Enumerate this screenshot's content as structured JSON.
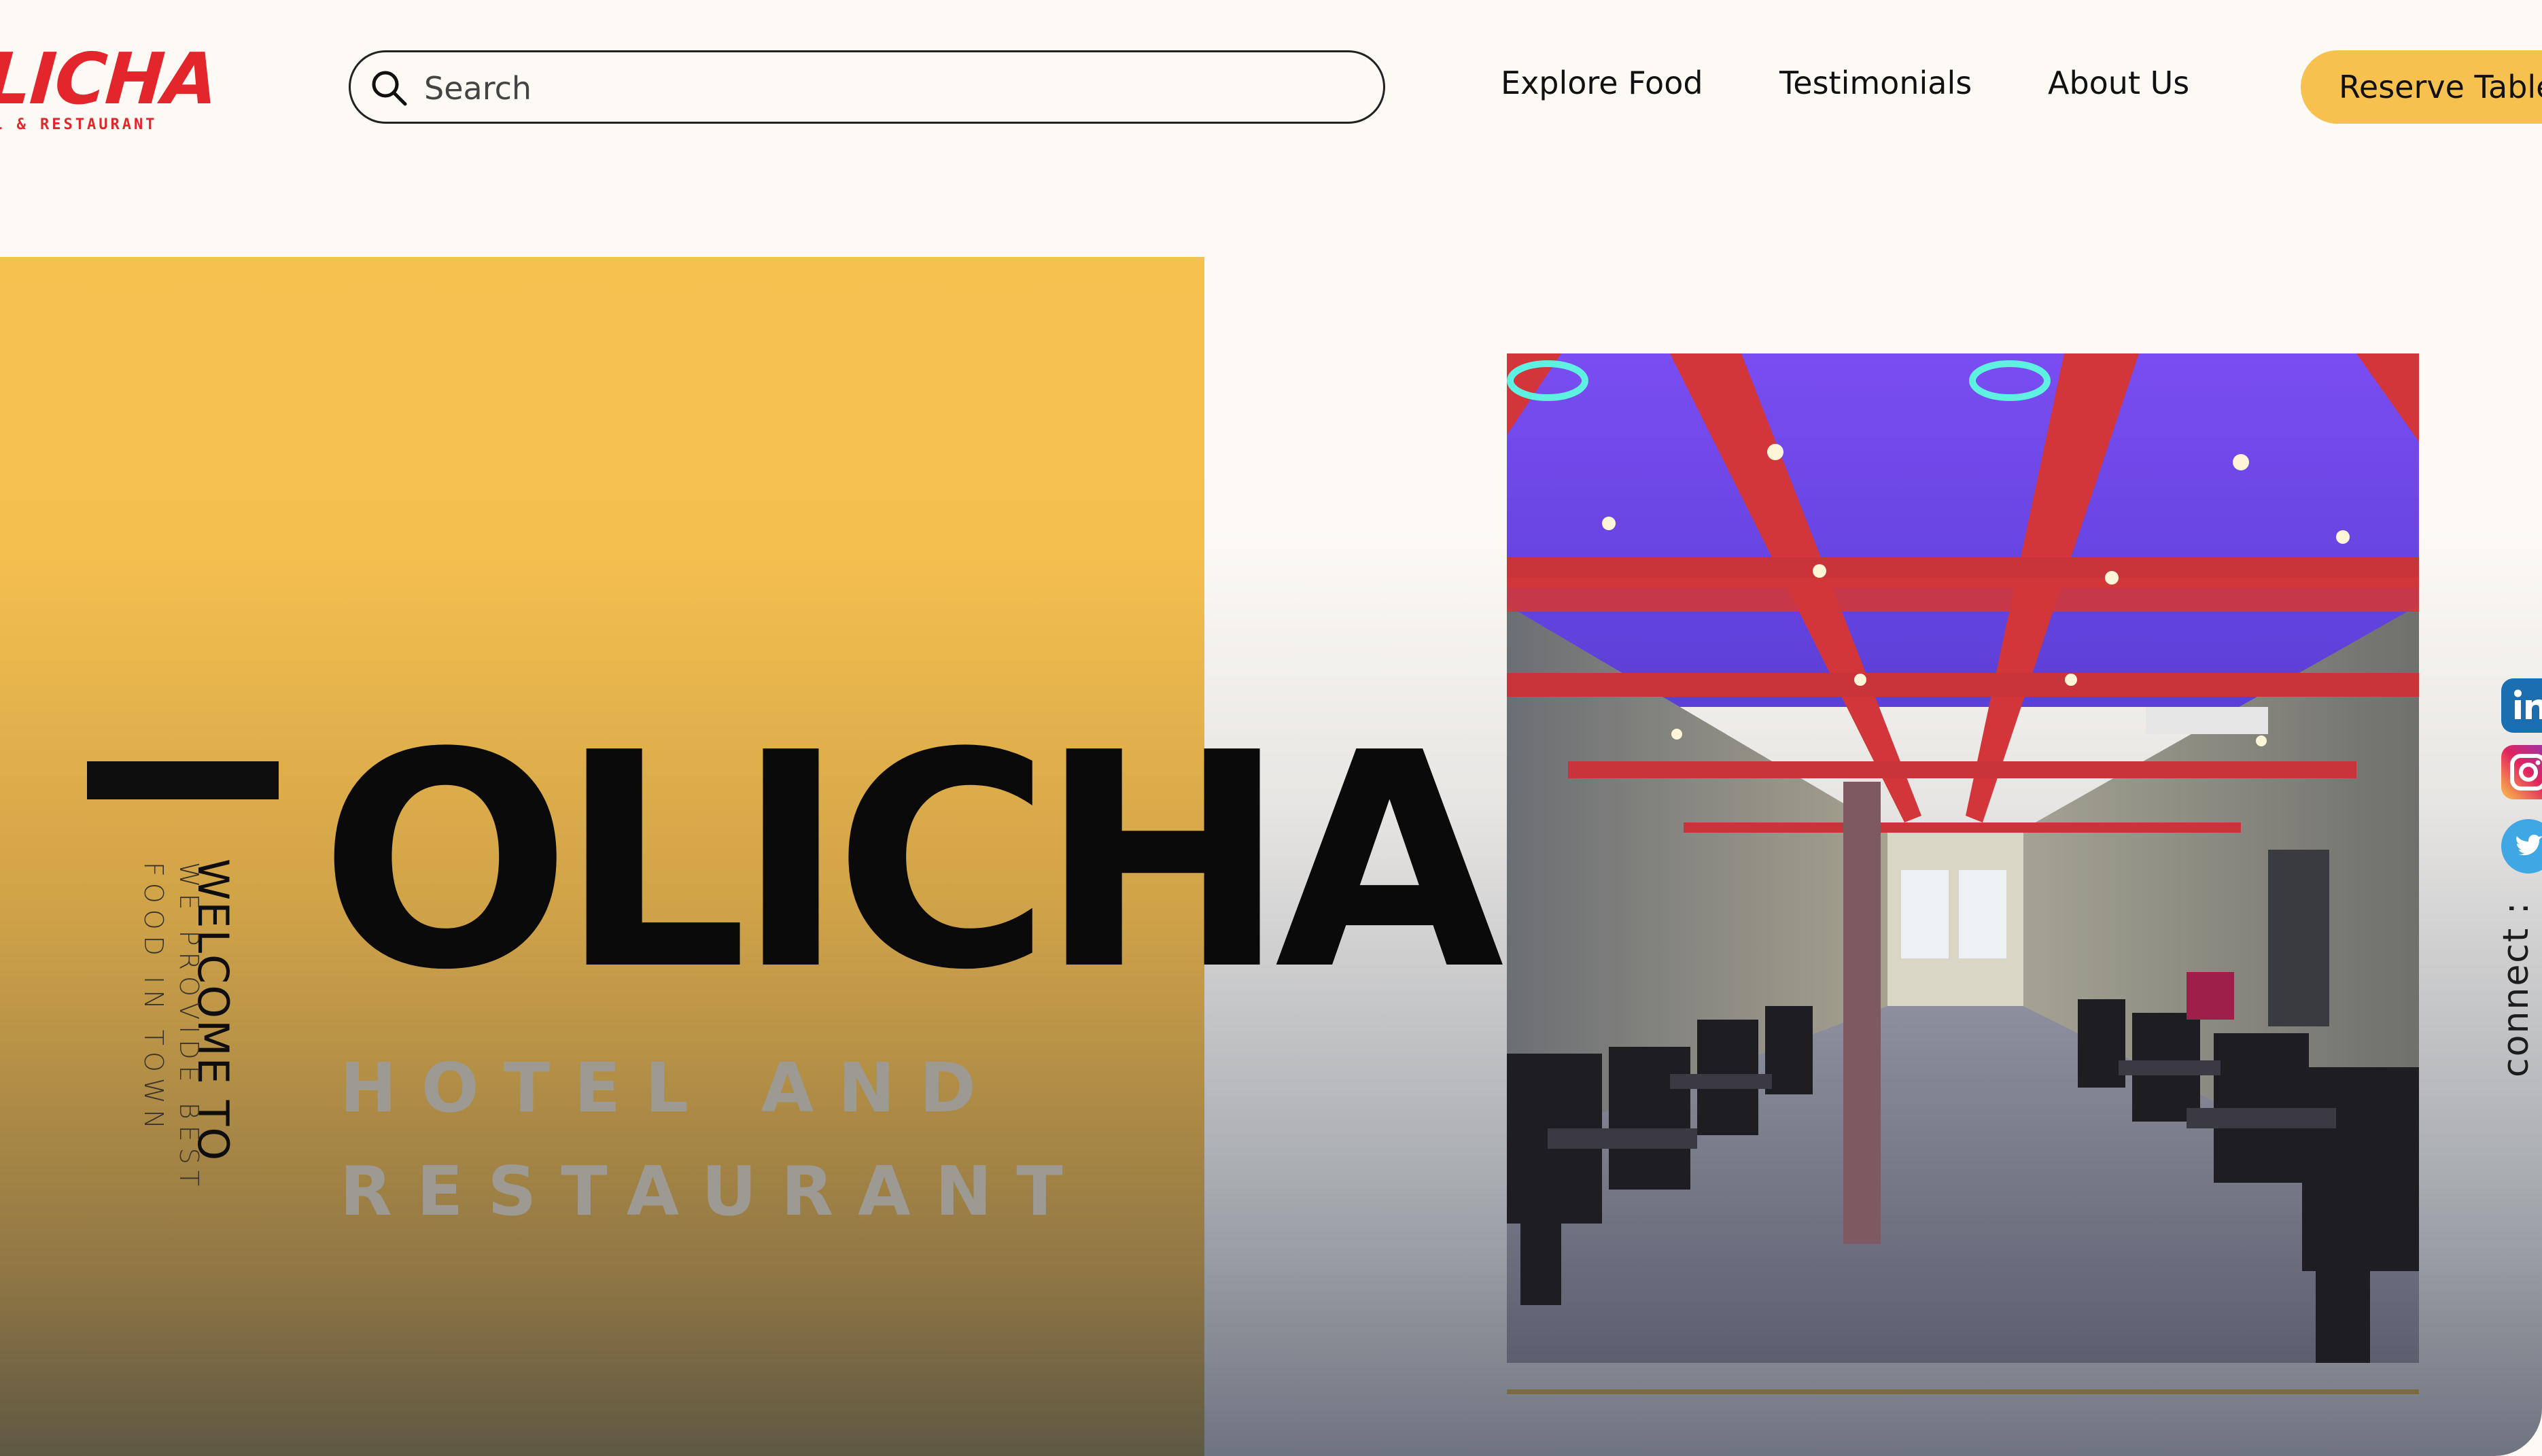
{
  "logo": {
    "name": "LICHA",
    "subtitle": "L & RESTAURANT"
  },
  "search": {
    "placeholder": "Search"
  },
  "nav": {
    "items": [
      {
        "label": "Explore Food"
      },
      {
        "label": "Testimonials"
      },
      {
        "label": "About Us"
      }
    ],
    "cta_label": "Reserve Table"
  },
  "hero": {
    "welcome": "WELCOME TO",
    "tagline_line1": "WE PROVIDE BEST",
    "tagline_line2": "FOOD IN TOWN",
    "title": "OLICHA",
    "subtitle_line1": "HOTEL AND",
    "subtitle_line2": "RESTAURANT"
  },
  "social": {
    "connect_label": "connect :",
    "icons": [
      "linkedin-icon",
      "instagram-icon",
      "twitter-icon"
    ]
  },
  "colors": {
    "accent_yellow": "#f7c14f",
    "brand_red": "#e3262b",
    "text_dark": "#0a0a0a"
  }
}
